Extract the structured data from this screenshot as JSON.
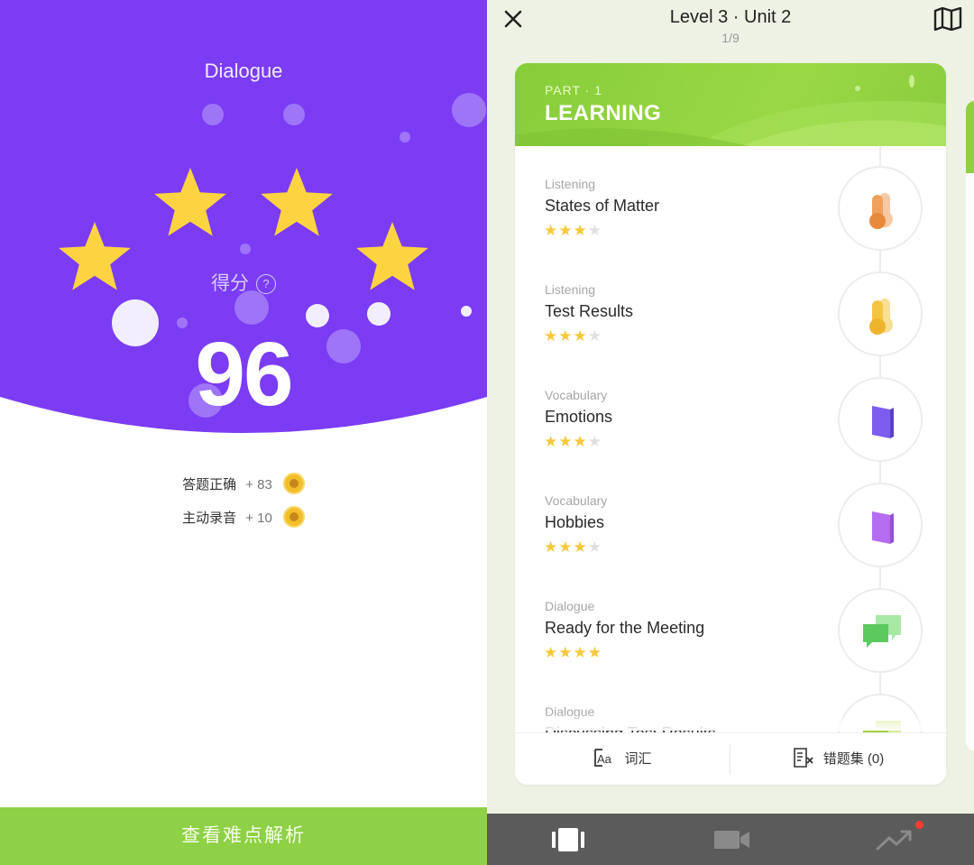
{
  "left": {
    "activity_title": "Dialogue",
    "score_label": "得分",
    "score_help": "?",
    "score": "96",
    "star_count": 4,
    "rewards": [
      {
        "label": "答题正确",
        "amount": "+ 83",
        "icon": "coin-icon"
      },
      {
        "label": "主动录音",
        "amount": "+ 10",
        "icon": "coin-icon"
      }
    ],
    "cta_label": "查看难点解析",
    "colors": {
      "hero": "#7b3cf4",
      "cta": "#8ed046",
      "star": "#fcd441"
    }
  },
  "right": {
    "header": {
      "title": "Level 3 · Unit 2",
      "pager": "1/9",
      "close_icon": "close-icon",
      "map_icon": "map-icon"
    },
    "card": {
      "part": "PART · 1",
      "section": "LEARNING",
      "lessons": [
        {
          "category": "Listening",
          "name": "States of Matter",
          "stars": 3,
          "max_stars": 4,
          "icon": "thermometer-icon",
          "icon_color": "#f0a15c"
        },
        {
          "category": "Listening",
          "name": "Test Results",
          "stars": 3,
          "max_stars": 4,
          "icon": "thermometer-icon",
          "icon_color": "#f4c443"
        },
        {
          "category": "Vocabulary",
          "name": "Emotions",
          "stars": 3,
          "max_stars": 4,
          "icon": "book-icon",
          "icon_color": "#7d5cf0"
        },
        {
          "category": "Vocabulary",
          "name": "Hobbies",
          "stars": 3,
          "max_stars": 4,
          "icon": "book-icon",
          "icon_color": "#b46cf0"
        },
        {
          "category": "Dialogue",
          "name": "Ready for the Meeting",
          "stars": 4,
          "max_stars": 4,
          "icon": "chat-bubbles-icon",
          "icon_color": "#5bc95e"
        },
        {
          "category": "Dialogue",
          "name": "Discussing Test Results",
          "stars": 0,
          "max_stars": 4,
          "icon": "chat-bubbles-icon",
          "icon_color": "#a5cf43"
        }
      ],
      "footer": {
        "vocab_label": "词汇",
        "mistakes_label": "错题集 (0)"
      }
    },
    "tabbar": {
      "tabs": [
        {
          "icon": "cards-icon",
          "active": true
        },
        {
          "icon": "video-camera-icon",
          "active": false
        },
        {
          "icon": "trend-chart-icon",
          "active": false,
          "has_notification": true
        }
      ]
    },
    "colors": {
      "bg": "#eef2e4",
      "banner": "#8fd03f",
      "tabbar": "#5b5b5b"
    }
  }
}
